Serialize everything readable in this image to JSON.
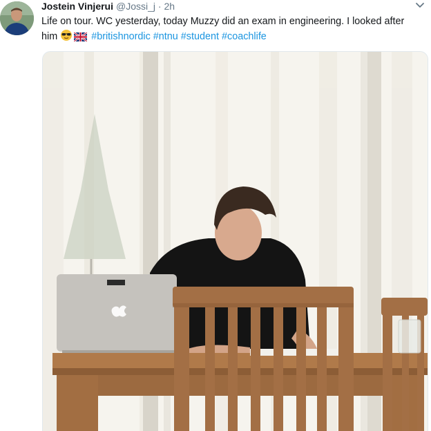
{
  "tweet": {
    "display_name": "Jostein Vinjerui",
    "handle": "@Jossi_j",
    "separator": "·",
    "time": "2h",
    "text_main": "Life on tour. WC yesterday, today Muzzy did an exam in engineering. I looked after him ",
    "hashtags": [
      "#britishnordic",
      "#ntnu",
      "#student",
      "#coachlife"
    ],
    "emoji": [
      "sunglasses-face",
      "union-jack-flag"
    ]
  },
  "icons": {
    "caret": "chevron-down-icon"
  },
  "colors": {
    "link": "#1b95e0",
    "secondary_text": "#657786",
    "primary_text": "#14171a"
  }
}
